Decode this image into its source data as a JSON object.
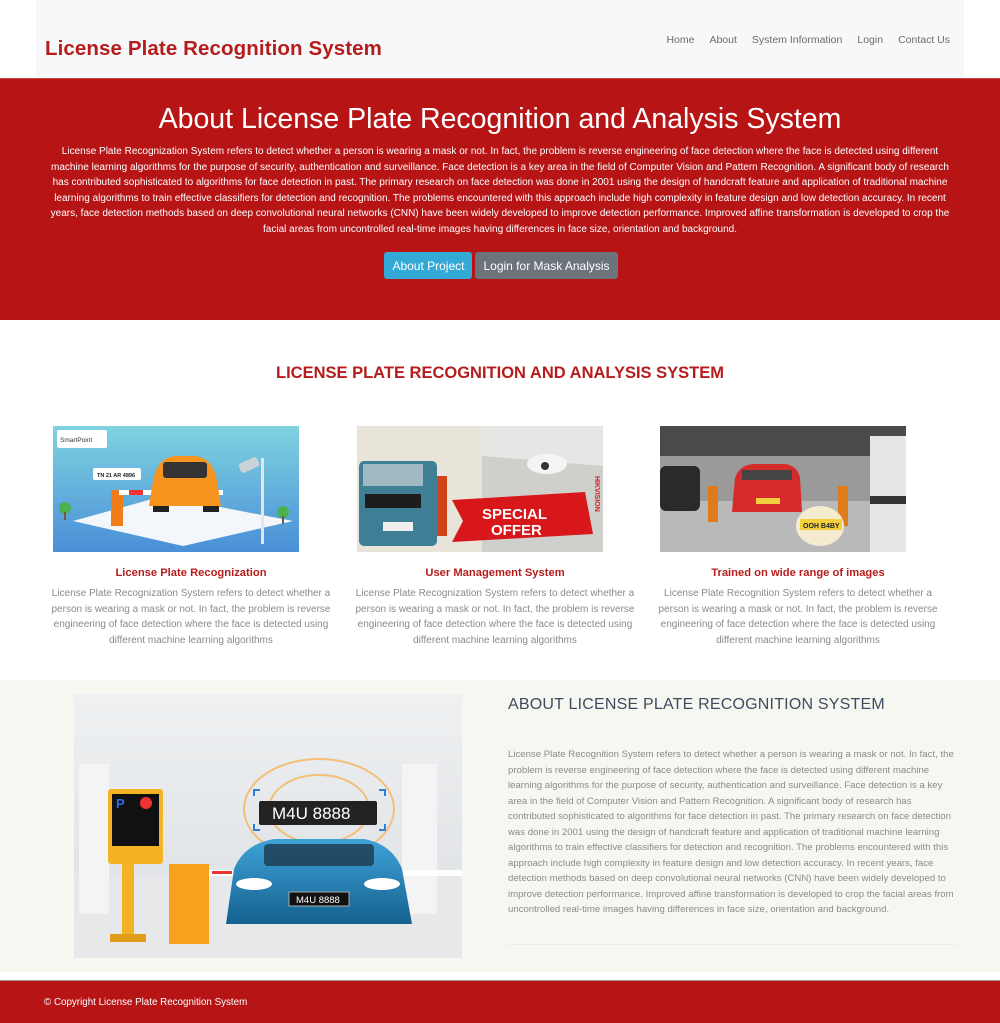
{
  "header": {
    "brand": "License Plate Recognition System",
    "nav": [
      "Home",
      "About",
      "System Information",
      "Login",
      "Contact Us"
    ]
  },
  "hero": {
    "title": "About License Plate Recognition and Analysis System",
    "text": "License Plate Recognization System refers to detect whether a person is wearing a mask or not. In fact, the problem is reverse engineering of face detection where the face is detected using different machine learning algorithms for the purpose of security, authentication and surveillance. Face detection is a key area in the field of Computer Vision and Pattern Recognition. A significant body of research has contributed sophisticated to algorithms for face detection in past. The primary research on face detection was done in 2001 using the design of handcraft feature and application of traditional machine learning algorithms to train effective classifiers for detection and recognition. The problems encountered with this approach include high complexity in feature design and low detection accuracy. In recent years, face detection methods based on deep convolutional neural networks (CNN) have been widely developed to improve detection performance. Improved affine transformation is developed to crop the facial areas from uncontrolled real-time images having differences in face size, orientation and background.",
    "buttons": {
      "about_project": "About Project",
      "login_mask": "Login for Mask Analysis"
    },
    "colors": {
      "background": "#b71416",
      "info_button": "#33a9d6",
      "secondary_button": "#6c737a"
    }
  },
  "features": {
    "title": "LICENSE PLATE RECOGNITION AND ANALYSIS SYSTEM",
    "items": [
      {
        "heading": "License Plate Recognization",
        "text": "License Plate Recognization System refers to detect whether a person is wearing a mask or not. In fact, the problem is reverse engineering of face detection where the face is detected using different machine learning algorithms",
        "image": {
          "logo": "SmartPoint",
          "plate": "TN 21 AR 4896"
        }
      },
      {
        "heading": "User Management System",
        "text": "License Plate Recognization System refers to detect whether a person is wearing a mask or not. In fact, the problem is reverse engineering of face detection where the face is detected using different machine learning algorithms",
        "image": {
          "banner_line1": "SPECIAL",
          "banner_line2": "OFFER",
          "brand": "HIKVISION"
        }
      },
      {
        "heading": "Trained on wide range of images",
        "text": "License Plate Recognition System refers to detect whether a person is wearing a mask or not. In fact, the problem is reverse engineering of face detection where the face is detected using different machine learning algorithms",
        "image": {
          "plate": "OOH B4BY"
        }
      }
    ]
  },
  "about": {
    "title": "ABOUT LICENSE PLATE RECOGNITION SYSTEM",
    "text": "License Plate Recognition System refers to detect whether a person is wearing a mask or not. In fact, the problem is reverse engineering of face detection where the face is detected using different machine learning algorithms for the purpose of security, authentication and surveillance. Face detection is a key area in the field of Computer Vision and Pattern Recognition. A significant body of research has contributed sophisticated to algorithms for face detection in past. The primary research on face detection was done in 2001 using the design of handcraft feature and application of traditional machine learning algorithms to train effective classifiers for detection and recognition. The problems encountered with this approach include high complexity in feature design and low detection accuracy. In recent years, face detection methods based on deep convolutional neural networks (CNN) have been widely developed to improve detection performance. Improved affine transformation is developed to crop the facial areas from uncontrolled real-time images having differences in face size, orientation and background.",
    "image": {
      "plate": "M4U 8888",
      "kiosk_letter": "P"
    }
  },
  "footer": {
    "copyright": "© Copyright License Plate Recognition System"
  }
}
